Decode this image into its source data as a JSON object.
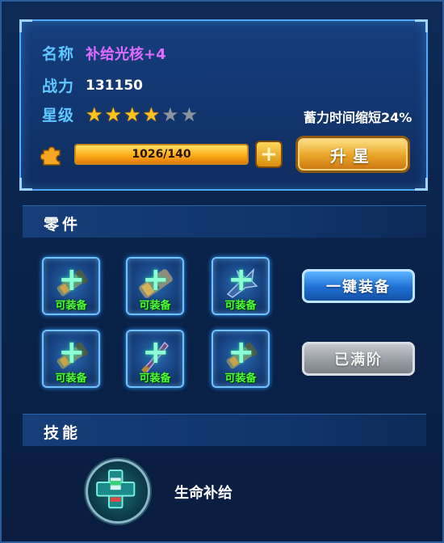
{
  "info": {
    "name_label": "名称",
    "name_value": "补给光核+4",
    "power_label": "战力",
    "power_value": "131150",
    "star_label": "星级",
    "stars_filled": 4,
    "stars_total": 6,
    "bonus_text": "蓄力时间缩短24%",
    "progress_text": "1026/140",
    "progress_fraction": 1.0,
    "upgrade_label": "升星"
  },
  "parts": {
    "header": "零件",
    "slots": [
      {
        "icon": "cannon-part-icon",
        "caption": "可装备"
      },
      {
        "icon": "barrel-part-icon",
        "caption": "可装备"
      },
      {
        "icon": "claw-part-icon",
        "caption": "可装备"
      },
      {
        "icon": "cannon-part-icon",
        "caption": "可装备"
      },
      {
        "icon": "blade-part-icon",
        "caption": "可装备"
      },
      {
        "icon": "cannon-part-icon",
        "caption": "可装备"
      }
    ],
    "equip_all_label": "一键装备",
    "maxed_label": "已满阶"
  },
  "skills": {
    "header": "技能",
    "skill_name": "生命补给",
    "skill_icon": "life-supply-icon"
  },
  "colors": {
    "label_cyan": "#5ec8ff",
    "name_purple": "#e06cff",
    "equip_green": "#4dff3a",
    "star_gold": "#ffc21f"
  }
}
